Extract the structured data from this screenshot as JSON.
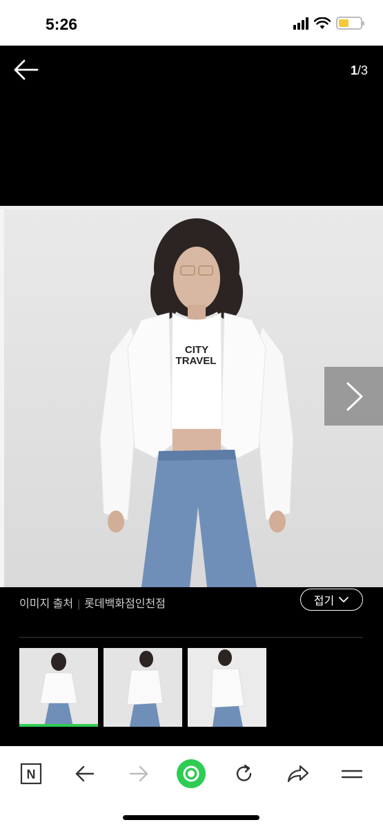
{
  "status_bar": {
    "time": "5:26",
    "battery_level": 0.45,
    "battery_color": "#f5c937"
  },
  "viewer": {
    "current": "1",
    "total": "/3"
  },
  "image": {
    "shirt_text_line1": "CITY",
    "shirt_text_line2": "TRAVEL"
  },
  "caption": {
    "source_label": "이미지 출처",
    "source_name": "롯데백화점인천점",
    "fold_label": "접기"
  },
  "thumbnails": [
    {
      "selected": true
    },
    {
      "selected": false
    },
    {
      "selected": false
    }
  ],
  "browser": {
    "naver_label": "N",
    "accent": "#2ecc52"
  }
}
